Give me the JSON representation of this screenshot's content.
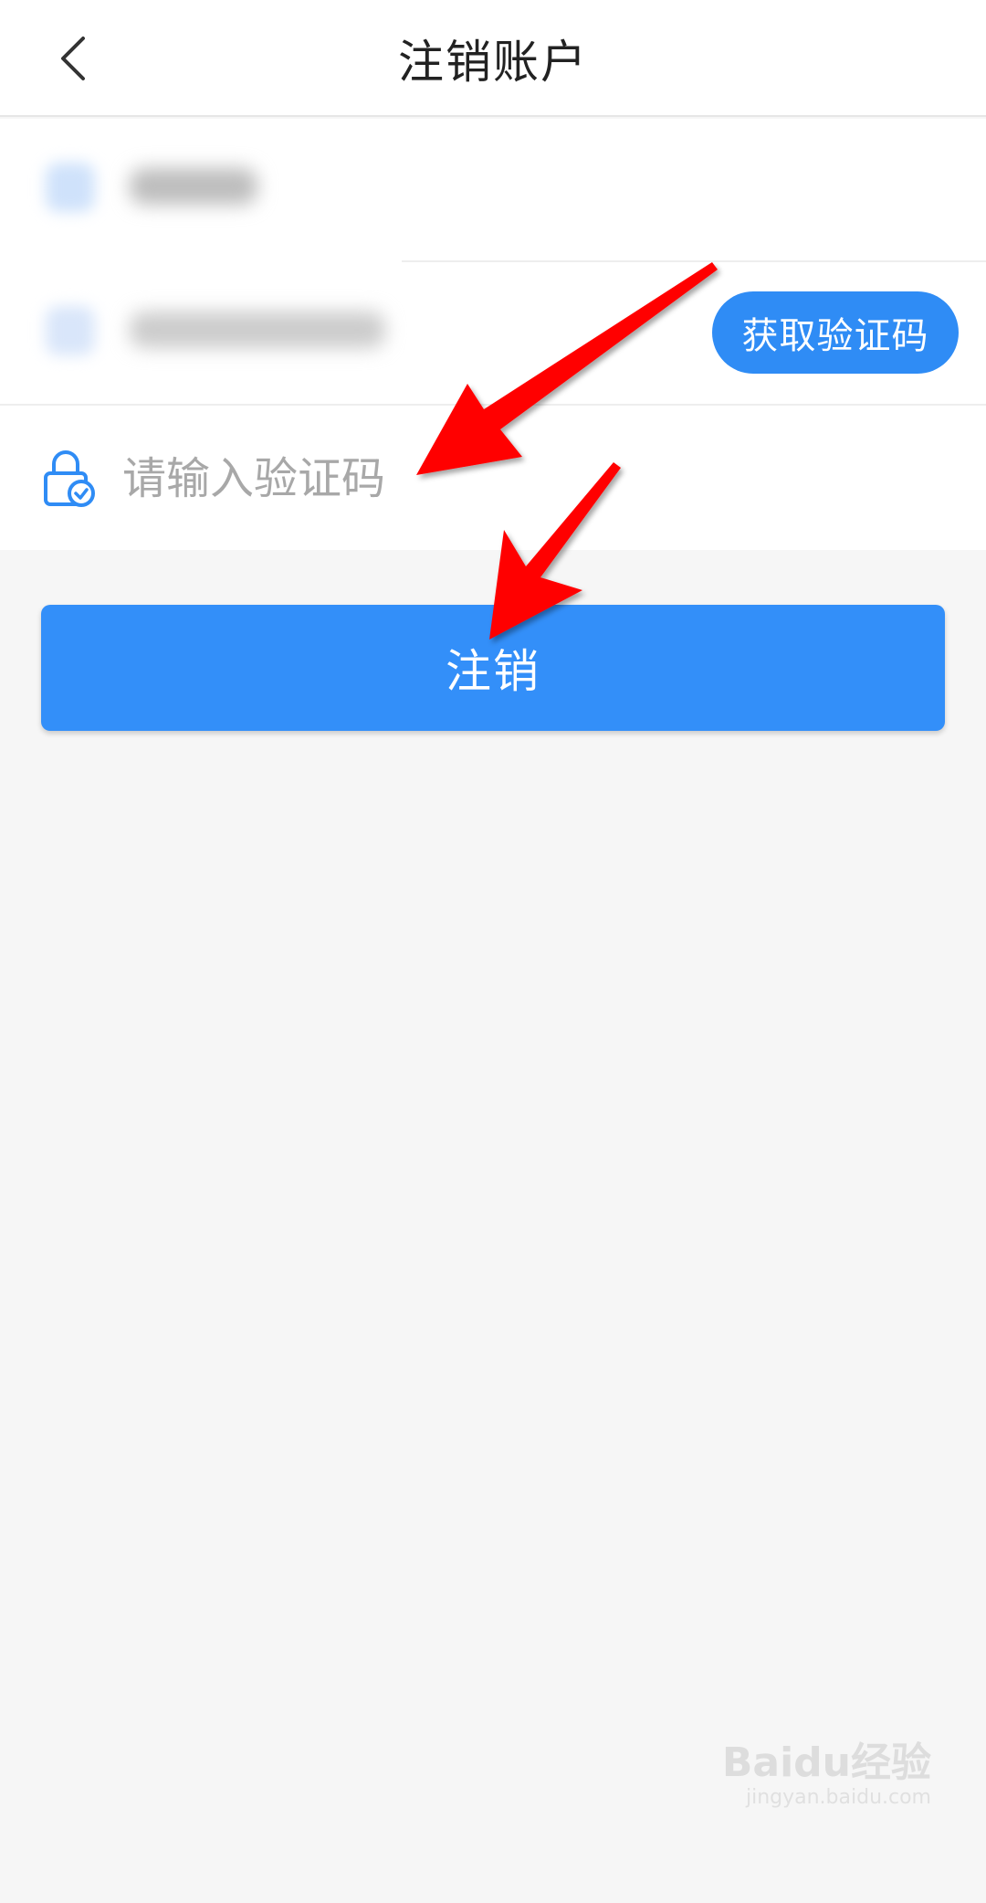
{
  "header": {
    "title": "注销账户",
    "back_icon": "chevron-left-icon"
  },
  "form": {
    "get_code_label": "获取验证码",
    "code_placeholder": "请输入验证码",
    "code_value": "",
    "lock_icon": "lock-check-icon"
  },
  "submit": {
    "label": "注销"
  },
  "watermark": {
    "logo": "Baidu经验",
    "site": "jingyan.baidu.com"
  },
  "colors": {
    "accent": "#338ff9",
    "annotation": "#ff0000",
    "background": "#f6f6f6"
  }
}
